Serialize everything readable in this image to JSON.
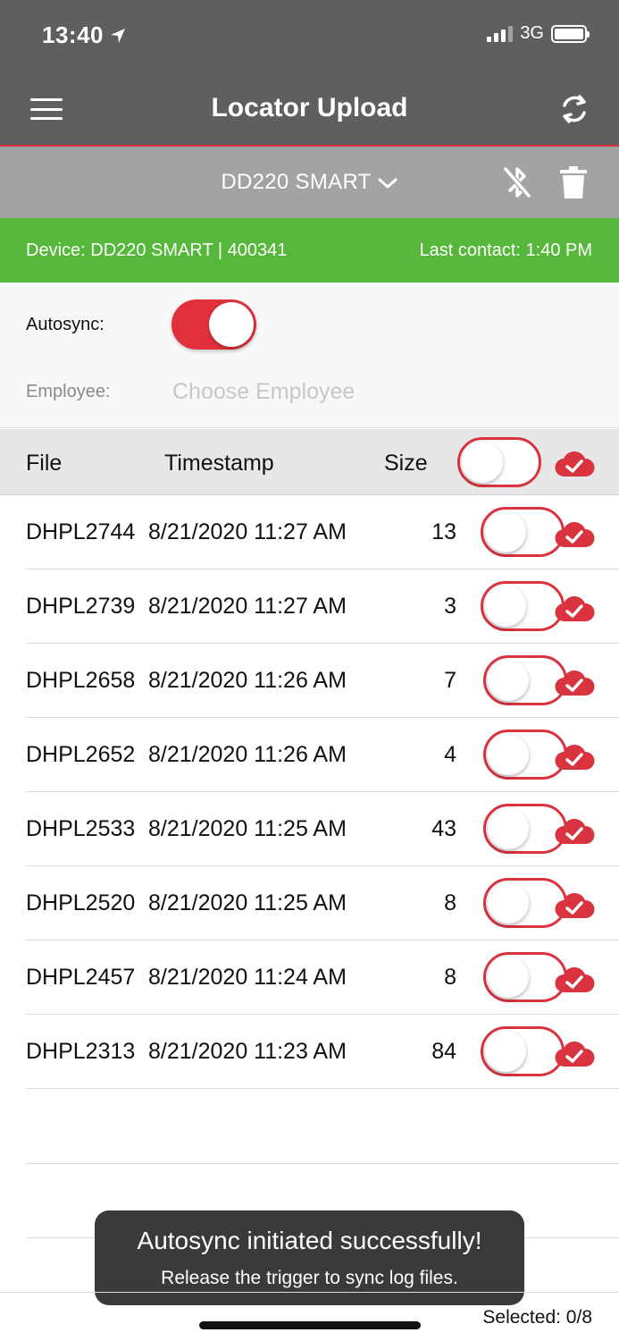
{
  "status_bar": {
    "time": "13:40",
    "network": "3G"
  },
  "header": {
    "title": "Locator Upload"
  },
  "device_bar": {
    "selected_device": "DD220 SMART"
  },
  "info_bar": {
    "device": "Device: DD220 SMART | 400341",
    "last_contact": "Last contact: 1:40 PM"
  },
  "settings": {
    "autosync_label": "Autosync:",
    "autosync_on": true,
    "employee_label": "Employee:",
    "employee_placeholder": "Choose Employee",
    "employee_value": ""
  },
  "table": {
    "headers": {
      "file": "File",
      "timestamp": "Timestamp",
      "size": "Size"
    },
    "rows": [
      {
        "file": "DHPL2744",
        "timestamp": "8/21/2020 11:27 AM",
        "size": "13"
      },
      {
        "file": "DHPL2739",
        "timestamp": "8/21/2020 11:27 AM",
        "size": "3"
      },
      {
        "file": "DHPL2658",
        "timestamp": "8/21/2020 11:26 AM",
        "size": "7"
      },
      {
        "file": "DHPL2652",
        "timestamp": "8/21/2020 11:26 AM",
        "size": "4"
      },
      {
        "file": "DHPL2533",
        "timestamp": "8/21/2020 11:25 AM",
        "size": "43"
      },
      {
        "file": "DHPL2520",
        "timestamp": "8/21/2020 11:25 AM",
        "size": "8"
      },
      {
        "file": "DHPL2457",
        "timestamp": "8/21/2020 11:24 AM",
        "size": "8"
      },
      {
        "file": "DHPL2313",
        "timestamp": "8/21/2020 11:23 AM",
        "size": "84"
      }
    ]
  },
  "toast": {
    "title": "Autosync initiated successfully!",
    "message": "Release the trigger to sync log files."
  },
  "footer": {
    "selected": "Selected: 0/8"
  },
  "colors": {
    "accent_red": "#d9333f",
    "header_gray": "#5f5f5f",
    "device_gray": "#a3a3a3",
    "status_green": "#56b83a"
  },
  "icons": {
    "menu": "hamburger-menu-icon",
    "sync": "sync-refresh-icon",
    "dropdown": "chevron-down-icon",
    "bluetooth": "bluetooth-disabled-icon",
    "trash": "trash-icon",
    "cloud": "cloud-check-icon"
  }
}
